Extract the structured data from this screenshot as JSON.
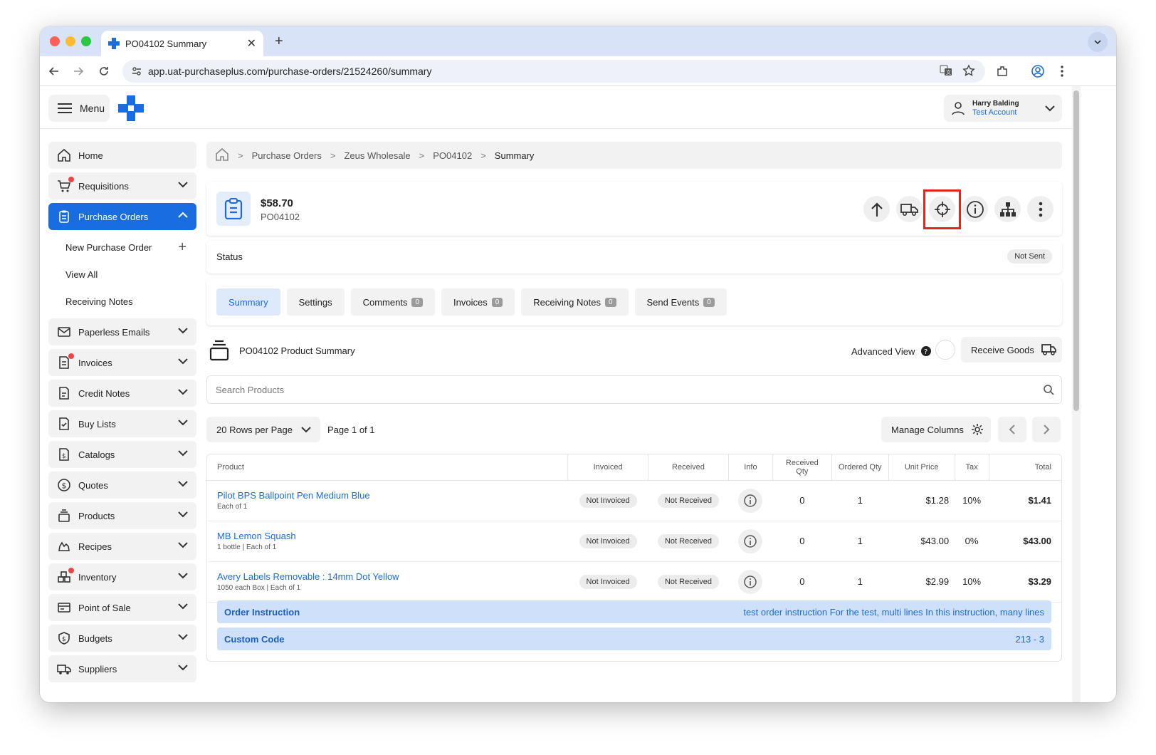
{
  "browser": {
    "tab_title": "PO04102 Summary",
    "url": "app.uat-purchaseplus.com/purchase-orders/21524260/summary"
  },
  "header": {
    "menu_label": "Menu",
    "user_name": "Harry Balding",
    "account_name": "Test Account"
  },
  "sidebar": {
    "items": [
      {
        "label": "Home"
      },
      {
        "label": "Requisitions"
      },
      {
        "label": "Purchase Orders"
      },
      {
        "label": "Paperless Emails"
      },
      {
        "label": "Invoices"
      },
      {
        "label": "Credit Notes"
      },
      {
        "label": "Buy Lists"
      },
      {
        "label": "Catalogs"
      },
      {
        "label": "Quotes"
      },
      {
        "label": "Products"
      },
      {
        "label": "Recipes"
      },
      {
        "label": "Inventory"
      },
      {
        "label": "Point of Sale"
      },
      {
        "label": "Budgets"
      },
      {
        "label": "Suppliers"
      }
    ],
    "sub_items": [
      {
        "label": "New Purchase Order"
      },
      {
        "label": "View All"
      },
      {
        "label": "Receiving Notes"
      }
    ]
  },
  "breadcrumb": [
    "Purchase Orders",
    "Zeus Wholesale",
    "PO04102",
    "Summary"
  ],
  "po": {
    "amount": "$58.70",
    "number": "PO04102",
    "status_label": "Status",
    "status_value": "Not Sent"
  },
  "tabs": [
    {
      "label": "Summary",
      "count": null
    },
    {
      "label": "Settings",
      "count": null
    },
    {
      "label": "Comments",
      "count": "0"
    },
    {
      "label": "Invoices",
      "count": "0"
    },
    {
      "label": "Receiving Notes",
      "count": "0"
    },
    {
      "label": "Send Events",
      "count": "0"
    }
  ],
  "summary": {
    "title": "PO04102 Product Summary",
    "advanced_view_label": "Advanced View",
    "receive_goods_label": "Receive Goods",
    "search_placeholder": "Search Products",
    "rows_per_page": "20 Rows per Page",
    "page_info": "Page 1 of 1",
    "manage_columns": "Manage Columns"
  },
  "table": {
    "columns": [
      "Product",
      "Invoiced",
      "Received",
      "Info",
      "Received Qty",
      "Ordered Qty",
      "Unit Price",
      "Tax",
      "Total"
    ],
    "rows": [
      {
        "product": "Pilot BPS Ballpoint Pen Medium Blue",
        "unit": "Each of 1",
        "invoiced": "Not Invoiced",
        "received": "Not Received",
        "received_qty": "0",
        "ordered_qty": "1",
        "unit_price": "$1.28",
        "tax": "10%",
        "total": "$1.41"
      },
      {
        "product": "MB Lemon Squash",
        "unit": "1 bottle | Each of 1",
        "invoiced": "Not Invoiced",
        "received": "Not Received",
        "received_qty": "0",
        "ordered_qty": "1",
        "unit_price": "$43.00",
        "tax": "0%",
        "total": "$43.00"
      },
      {
        "product": "Avery Labels Removable : 14mm Dot Yellow",
        "unit": "1050 each Box | Each of 1",
        "invoiced": "Not Invoiced",
        "received": "Not Received",
        "received_qty": "0",
        "ordered_qty": "1",
        "unit_price": "$2.99",
        "tax": "10%",
        "total": "$3.29"
      }
    ]
  },
  "order_instruction": {
    "label": "Order Instruction",
    "value": "test order instruction For the test, multi lines In this instruction, many lines"
  },
  "custom_code": {
    "label": "Custom Code",
    "value": "213 - 3"
  },
  "colors": {
    "accent": "#1a6de0",
    "highlight_box": "#e3261b",
    "notification_dot": "#ef4444"
  }
}
